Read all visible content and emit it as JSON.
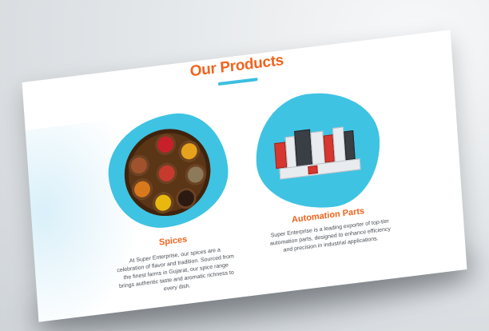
{
  "section": {
    "title": "Our Products",
    "accent_color": "#f0641e",
    "underline_color": "#3bbfe0",
    "blob_color": "#3ec3e3"
  },
  "products": [
    {
      "name": "Spices",
      "description": "At Super Enterprise, our spices are a celebration of flavor and tradition. Sourced from the finest farms in Gujarat, our spice range brings authentic taste and aromatic richness to every dish.",
      "image": "spices-tray-image"
    },
    {
      "name": "Automation Parts",
      "description": "Super Enterprise is a leading exporter of top-tier automation parts, designed to enhance efficiency and precision in industrial applications.",
      "image": "automation-parts-image"
    }
  ]
}
